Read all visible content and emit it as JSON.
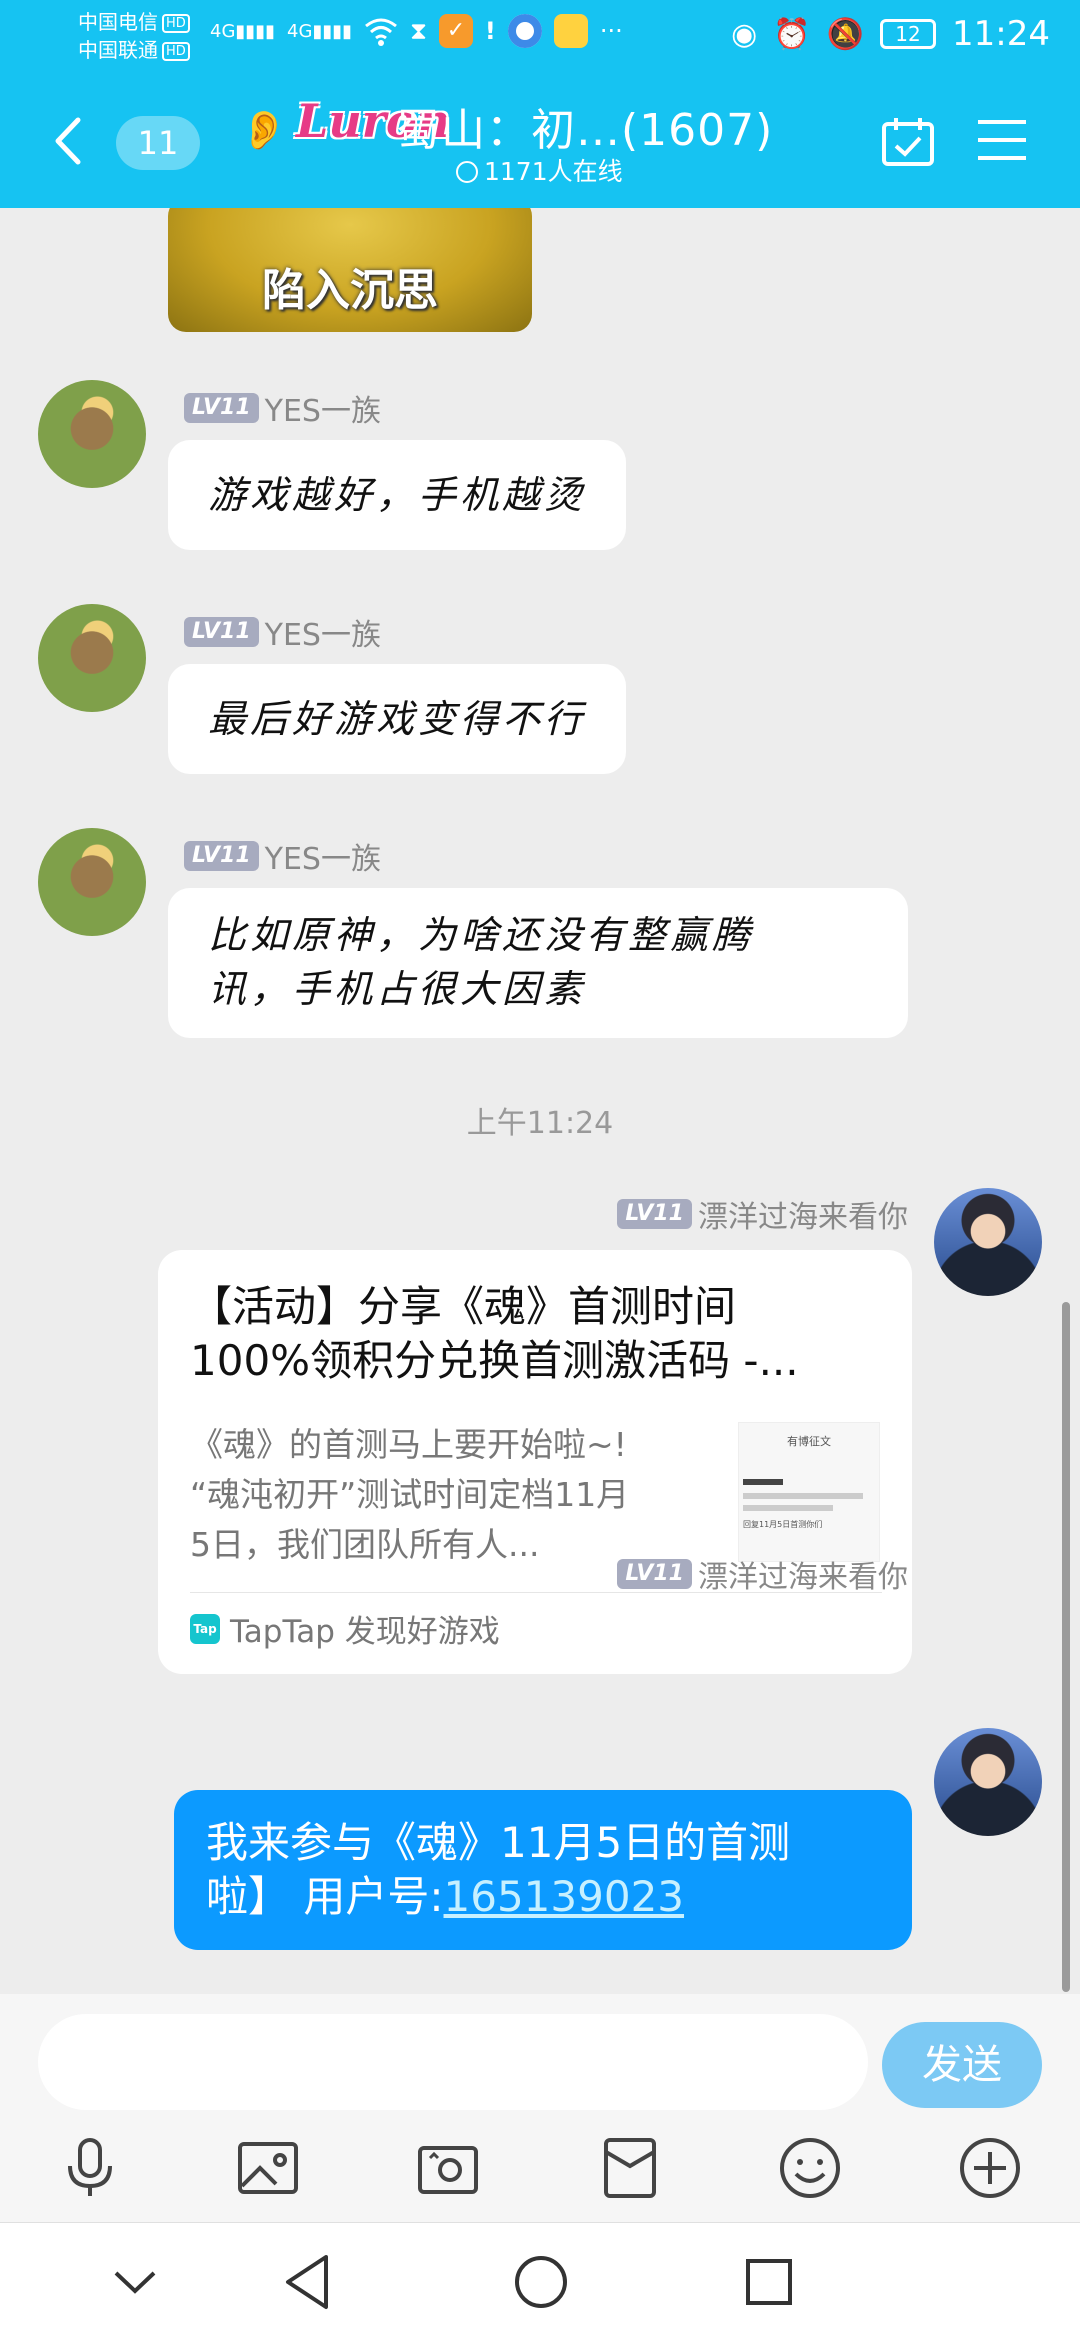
{
  "status_bar": {
    "carrier1": "中国电信",
    "carrier2": "中国联通",
    "hd": "HD",
    "network": "4G",
    "battery": "12",
    "time": "11:24",
    "more": "···"
  },
  "header": {
    "unread_count": "11",
    "logo_text": "Luron",
    "title": "蜀山：初…(1607)",
    "online": "1171人在线"
  },
  "chat": {
    "sticker_text": "陷入沉思",
    "messages": [
      {
        "level": "LV11",
        "sender": "YES一族",
        "text_lines": [
          "游戏越好，手机越烫"
        ]
      },
      {
        "level": "LV11",
        "sender": "YES一族",
        "text_lines": [
          "最后好游戏变得不行"
        ]
      },
      {
        "level": "LV11",
        "sender": "YES一族",
        "text_lines": [
          "比如原神，为啥还没有整赢腾",
          "讯，手机占很大因素"
        ]
      }
    ],
    "timestamp": "上午11:24",
    "share": {
      "level": "LV11",
      "sender": "漂洋过海来看你",
      "title_lines": [
        "【活动】分享《魂》首测时间",
        "100%领积分兑换首测激活码 -..."
      ],
      "desc_lines": [
        "《魂》的首测马上要开始啦~!",
        "“魂沌初开”测试时间定档11月",
        "5日，我们团队所有人..."
      ],
      "thumb_title": "有博征文",
      "thumb_link": "回复11月5日首测你们",
      "source_icon": "Tap",
      "source": "TapTap 发现好游戏"
    },
    "reply": {
      "level": "LV11",
      "sender": "漂洋过海来看你",
      "text_line1": "我来参与《魂》11月5日的首测",
      "text_line2_prefix": "啦】 用户号:",
      "user_id": "165139023"
    }
  },
  "composer": {
    "input_value": "",
    "send_label": "发送"
  }
}
